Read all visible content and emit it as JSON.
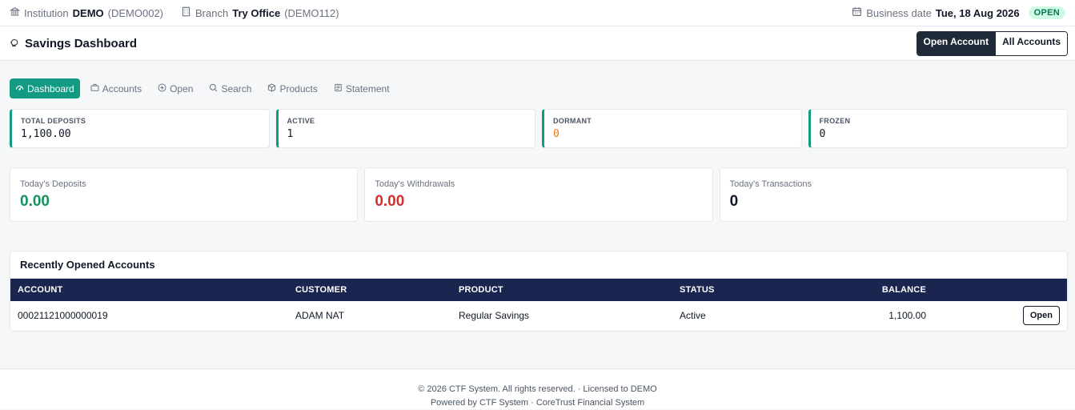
{
  "topbar": {
    "institution_label": "Institution",
    "institution_name": "DEMO",
    "institution_code": "(DEMO002)",
    "branch_label": "Branch",
    "branch_name": "Try Office",
    "branch_code": "(DEMO112)",
    "business_date_label": "Business date",
    "business_date": "Tue, 18 Aug 2026",
    "status": "OPEN"
  },
  "header": {
    "title": "Savings Dashboard",
    "open_account_label": "Open Account",
    "all_accounts_label": "All Accounts"
  },
  "tabs": [
    {
      "label": "Dashboard",
      "icon": "gauge-icon",
      "active": true
    },
    {
      "label": "Accounts",
      "icon": "briefcase-icon"
    },
    {
      "label": "Open",
      "icon": "plus-circle-icon"
    },
    {
      "label": "Search",
      "icon": "search-icon"
    },
    {
      "label": "Products",
      "icon": "box-icon"
    },
    {
      "label": "Statement",
      "icon": "document-icon"
    }
  ],
  "stats": [
    {
      "label": "TOTAL DEPOSITS",
      "value": "1,100.00"
    },
    {
      "label": "ACTIVE",
      "value": "1"
    },
    {
      "label": "DORMANT",
      "value": "0"
    },
    {
      "label": "FROZEN",
      "value": "0"
    }
  ],
  "today": [
    {
      "label": "Today's Deposits",
      "value": "0.00"
    },
    {
      "label": "Today's Withdrawals",
      "value": "0.00"
    },
    {
      "label": "Today's Transactions",
      "value": "0"
    }
  ],
  "recent": {
    "title": "Recently Opened Accounts",
    "columns": [
      "ACCOUNT",
      "CUSTOMER",
      "PRODUCT",
      "STATUS",
      "BALANCE"
    ],
    "rows": [
      {
        "account": "00021121000000019",
        "customer": "ADAM NAT",
        "product": "Regular Savings",
        "status": "Active",
        "balance": "1,100.00",
        "action": "Open"
      }
    ]
  },
  "footer": {
    "line1": "© 2026 CTF System. All rights reserved. · Licensed to DEMO",
    "line2": "Powered by CTF System · CoreTrust Financial System"
  },
  "colors": {
    "accent": "#129a82",
    "table_header": "#1a2550",
    "positive": "#15915b",
    "negative": "#d32f2f",
    "warning": "#ea7a17"
  }
}
